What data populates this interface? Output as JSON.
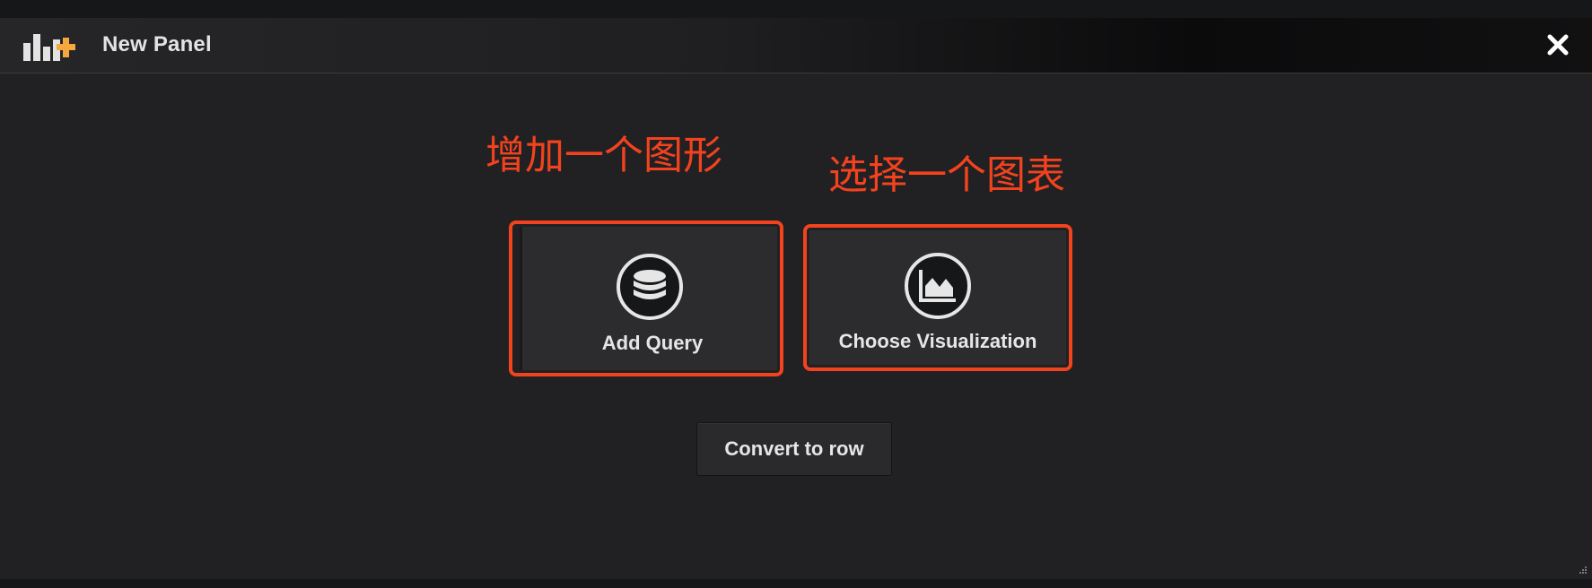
{
  "header": {
    "title": "New Panel",
    "logo_icon": "panel-add-icon",
    "close_icon": "close-icon"
  },
  "annotations": {
    "add_query_note": "增加一个图形",
    "visualization_note": "选择一个图表"
  },
  "actions": [
    {
      "label": "Add Query",
      "icon": "database-icon"
    },
    {
      "label": "Choose Visualization",
      "icon": "area-chart-icon"
    }
  ],
  "convert_button": {
    "label": "Convert to row"
  },
  "colors": {
    "accent": "#f3421e",
    "logo_plus": "#f7a73b",
    "background": "#212124",
    "text": "#e6e6e7"
  }
}
